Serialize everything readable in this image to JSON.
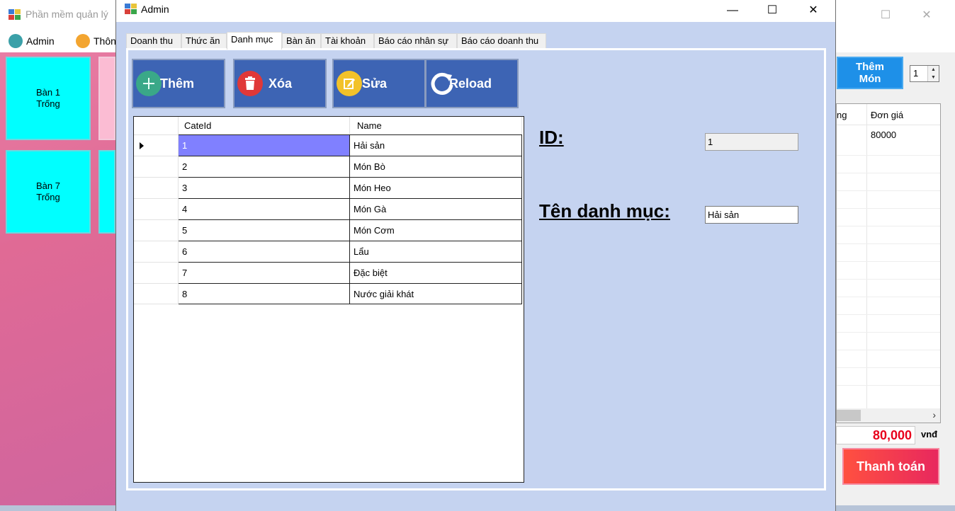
{
  "main_window": {
    "title": "Phần mềm quản lý",
    "menu": [
      {
        "label": "Admin"
      },
      {
        "label": "Thôn"
      }
    ],
    "tables": [
      {
        "name": "Bàn 1",
        "status": "Trống"
      },
      {
        "name": "Bàn 7",
        "status": "Trống"
      }
    ],
    "add_dish_button": {
      "line1": "Thêm",
      "line2": "Món"
    },
    "quantity": "1",
    "bill": {
      "headers": [
        "ng",
        "Đơn giá"
      ],
      "price": "80000"
    },
    "total": "80,000",
    "currency": "vnđ",
    "pay_button": "Thanh toán"
  },
  "admin": {
    "title": "Admin",
    "tabs": [
      {
        "label": "Doanh thu"
      },
      {
        "label": "Thức ăn"
      },
      {
        "label": "Danh mục"
      },
      {
        "label": "Bàn ăn"
      },
      {
        "label": "Tài khoản"
      },
      {
        "label": "Báo cáo nhân sự"
      },
      {
        "label": "Báo cáo doanh thu"
      }
    ],
    "active_tab": "Danh mục",
    "actions": {
      "add": "Thêm",
      "delete": "Xóa",
      "edit": "Sửa",
      "reload": "Reload"
    },
    "grid": {
      "columns": [
        "CateId",
        "Name"
      ],
      "rows": [
        {
          "id": "1",
          "name": "Hải sản"
        },
        {
          "id": "2",
          "name": "Món Bò"
        },
        {
          "id": "3",
          "name": "Món Heo"
        },
        {
          "id": "4",
          "name": "Món Gà"
        },
        {
          "id": "5",
          "name": "Món Cơm"
        },
        {
          "id": "6",
          "name": "Lẩu"
        },
        {
          "id": "7",
          "name": "Đặc biệt"
        },
        {
          "id": "8",
          "name": "Nước giải khát"
        }
      ]
    },
    "form": {
      "id_label": "ID:",
      "id_value": "1",
      "name_label": "Tên danh mục:",
      "name_value": "Hải sản"
    }
  },
  "colors": {
    "dialog_bg": "#c5d3f0",
    "action_button": "#3d64b4",
    "selected_cell": "#8080ff",
    "table_empty": "#00ffff",
    "total_text": "#e8001c"
  }
}
